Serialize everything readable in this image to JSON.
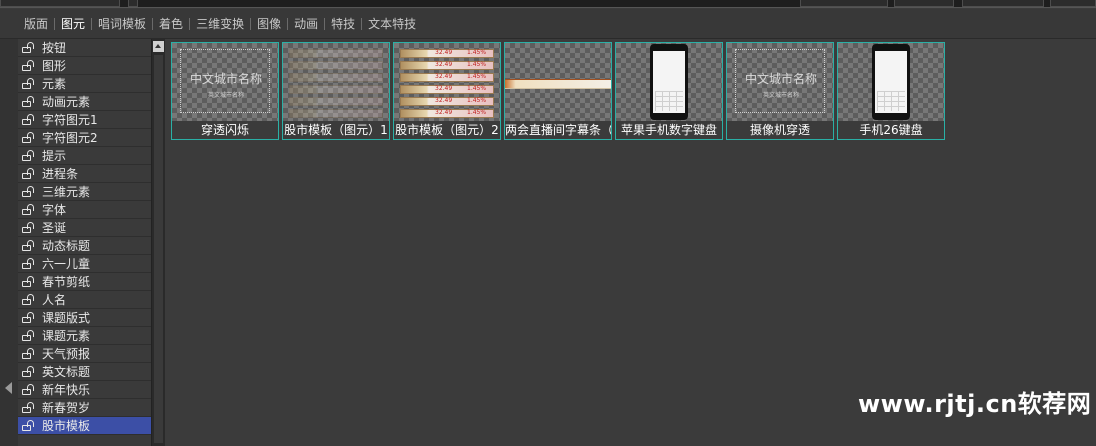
{
  "tabs": [
    {
      "label": "版面",
      "active": false
    },
    {
      "label": "图元",
      "active": true
    },
    {
      "label": "唱词模板",
      "active": false
    },
    {
      "label": "着色",
      "active": false
    },
    {
      "label": "三维变换",
      "active": false
    },
    {
      "label": "图像",
      "active": false
    },
    {
      "label": "动画",
      "active": false
    },
    {
      "label": "特技",
      "active": false
    },
    {
      "label": "文本特技",
      "active": false
    }
  ],
  "tree": {
    "items": [
      "按钮",
      "图形",
      "元素",
      "动画元素",
      "字符图元1",
      "字符图元2",
      "提示",
      "进程条",
      "三维元素",
      "字体",
      "圣诞",
      "动态标题",
      "六一儿童",
      "春节剪纸",
      "人名",
      "课题版式",
      "课题元素",
      "天气预报",
      "英文标题",
      "新年快乐",
      "新春贺岁",
      "股市模板"
    ],
    "selected_index": 21,
    "item_icon": "lock-icon"
  },
  "thumbnails": [
    {
      "label": "穿透闪烁",
      "art": "frame",
      "big_text": "中文城市名称",
      "small_text": "英文城市名称"
    },
    {
      "label": "股市模板（图元）1",
      "art": "ghost-rows"
    },
    {
      "label": "股市模板（图元）2",
      "art": "rows",
      "row_values": [
        "32.49",
        "1.45%"
      ]
    },
    {
      "label": "两会直播间字幕条（图",
      "art": "strip"
    },
    {
      "label": "苹果手机数字键盘",
      "art": "phone"
    },
    {
      "label": "摄像机穿透",
      "art": "frame",
      "big_text": "中文城市名称",
      "small_text": "英文城市名称"
    },
    {
      "label": "手机26键盘",
      "art": "phone"
    }
  ],
  "watermark": "www.rjtj.cn软荐网",
  "colors": {
    "selection": "#3c4fa6",
    "thumb_border": "#2ab0a6",
    "background": "#3b3b3b"
  }
}
